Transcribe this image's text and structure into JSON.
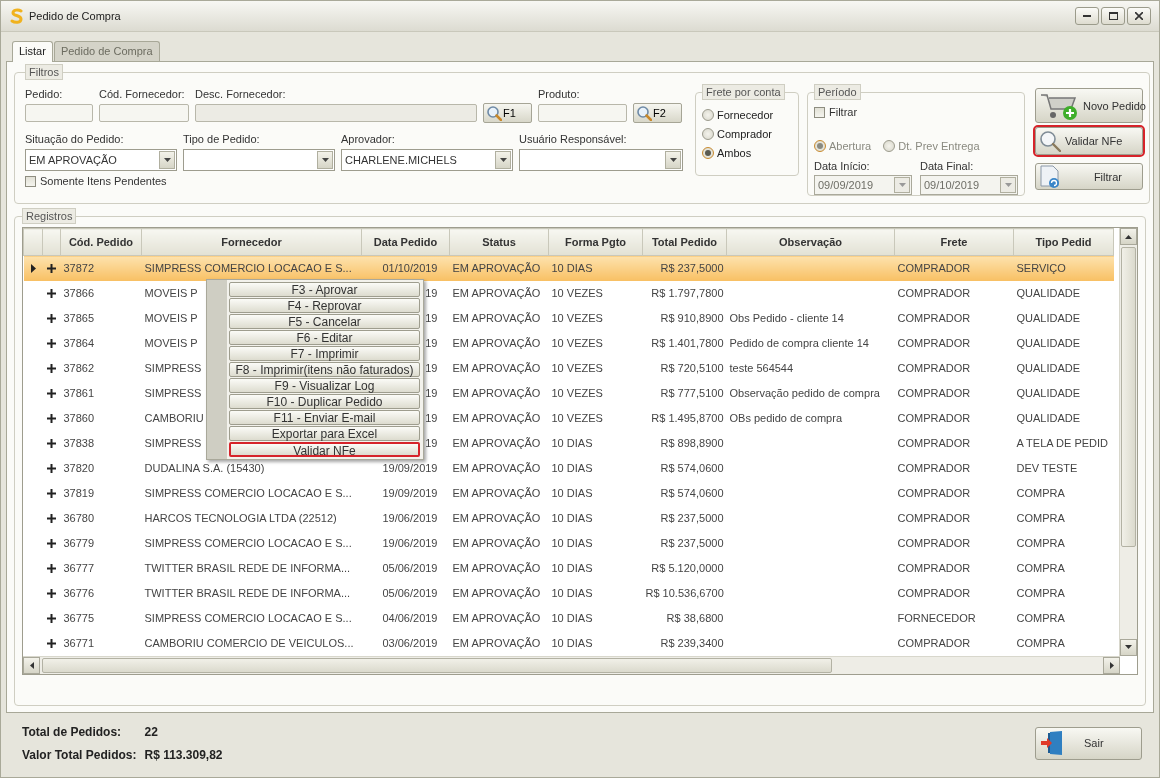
{
  "window": {
    "title": "Pedido de Compra"
  },
  "tabs": [
    {
      "label": "Listar",
      "selected": true
    },
    {
      "label": "Pedido de Compra",
      "selected": false
    }
  ],
  "filtros": {
    "title": "Filtros",
    "pedido": {
      "label": "Pedido:"
    },
    "cod_fornecedor": {
      "label": "Cód. Fornecedor:"
    },
    "desc_fornecedor": {
      "label": "Desc. Fornecedor:",
      "disabled": true
    },
    "f1_button": {
      "label": "F1"
    },
    "produto": {
      "label": "Produto:"
    },
    "f2_button": {
      "label": "F2"
    },
    "situacao": {
      "label": "Situação do Pedido:",
      "value": "EM APROVAÇÃO"
    },
    "tipo": {
      "label": "Tipo de Pedido:"
    },
    "aprovador": {
      "label": "Aprovador:",
      "value": "CHARLENE.MICHELS"
    },
    "usuario": {
      "label": "Usuário Responsável:"
    },
    "somente_pendentes": {
      "label": "Somente Itens Pendentes",
      "checked": false
    }
  },
  "frete": {
    "title": "Frete por conta",
    "options": [
      {
        "label": "Fornecedor",
        "selected": false
      },
      {
        "label": "Comprador",
        "selected": false
      },
      {
        "label": "Ambos",
        "selected": true
      }
    ]
  },
  "periodo": {
    "title": "Período",
    "filtrar": {
      "label": "Filtrar",
      "checked": false
    },
    "options": [
      {
        "label": "Abertura",
        "selected": true,
        "disabled": true
      },
      {
        "label": "Dt. Prev Entrega",
        "selected": false,
        "disabled": true
      }
    ],
    "data_inicio": {
      "label": "Data Início:",
      "value": "09/09/2019",
      "disabled": true
    },
    "data_final": {
      "label": "Data Final:",
      "value": "09/10/2019",
      "disabled": true
    }
  },
  "actions": [
    {
      "kind": "new",
      "label": "Novo Pedido",
      "highlighted": false
    },
    {
      "kind": "validate",
      "label": "Validar NFe",
      "highlighted": true
    },
    {
      "kind": "filter",
      "label": "Filtrar",
      "highlighted": false
    }
  ],
  "registros": {
    "title": "Registros",
    "columns": [
      "Cód. Pedido",
      "Fornecedor",
      "Data Pedido",
      "Status",
      "Forma Pgto",
      "Total Pedido",
      "Observação",
      "Frete",
      "Tipo Pedid"
    ],
    "rows": [
      {
        "selected": true,
        "cells": [
          "37872",
          "SIMPRESS COMERCIO LOCACAO E S...",
          "01/10/2019",
          "EM APROVAÇÃO",
          "10 DIAS",
          "R$ 237,5000",
          null,
          "COMPRADOR",
          "SERVIÇO"
        ]
      },
      {
        "selected": false,
        "cells": [
          "37866",
          "MOVEIS P",
          "19",
          "EM APROVAÇÃO",
          "10 VEZES",
          "R$ 1.797,7800",
          null,
          "COMPRADOR",
          "QUALIDADE"
        ]
      },
      {
        "selected": false,
        "cells": [
          "37865",
          "MOVEIS P",
          "19",
          "EM APROVAÇÃO",
          "10 VEZES",
          "R$ 910,8900",
          "Obs Pedido - cliente 14",
          "COMPRADOR",
          "QUALIDADE"
        ]
      },
      {
        "selected": false,
        "cells": [
          "37864",
          "MOVEIS P",
          "19",
          "EM APROVAÇÃO",
          "10 VEZES",
          "R$ 1.401,7800",
          "Pedido de compra cliente 14",
          "COMPRADOR",
          "QUALIDADE"
        ]
      },
      {
        "selected": false,
        "cells": [
          "37862",
          "SIMPRESS",
          "19",
          "EM APROVAÇÃO",
          "10 VEZES",
          "R$ 720,5100",
          "teste 564544",
          "COMPRADOR",
          "QUALIDADE"
        ]
      },
      {
        "selected": false,
        "cells": [
          "37861",
          "SIMPRESS",
          "19",
          "EM APROVAÇÃO",
          "10 VEZES",
          "R$ 777,5100",
          "Observação pedido de compra",
          "COMPRADOR",
          "QUALIDADE"
        ]
      },
      {
        "selected": false,
        "cells": [
          "37860",
          "CAMBORIU",
          "19",
          "EM APROVAÇÃO",
          "10 VEZES",
          "R$ 1.495,8700",
          "OBs pedido de compra",
          "COMPRADOR",
          "QUALIDADE"
        ]
      },
      {
        "selected": false,
        "cells": [
          "37838",
          "SIMPRESS",
          "19",
          "EM APROVAÇÃO",
          "10 DIAS",
          "R$ 898,8900",
          null,
          "COMPRADOR",
          "A TELA DE PEDID"
        ]
      },
      {
        "selected": false,
        "cells": [
          "37820",
          "DUDALINA S.A. (15430)",
          "19/09/2019",
          "EM APROVAÇÃO",
          "10 DIAS",
          "R$ 574,0600",
          null,
          "COMPRADOR",
          "DEV TESTE"
        ]
      },
      {
        "selected": false,
        "cells": [
          "37819",
          "SIMPRESS COMERCIO LOCACAO E S...",
          "19/09/2019",
          "EM APROVAÇÃO",
          "10 DIAS",
          "R$ 574,0600",
          null,
          "COMPRADOR",
          "COMPRA"
        ]
      },
      {
        "selected": false,
        "cells": [
          "36780",
          "HARCOS TECNOLOGIA LTDA (22512)",
          "19/06/2019",
          "EM APROVAÇÃO",
          "10 DIAS",
          "R$ 237,5000",
          null,
          "COMPRADOR",
          "COMPRA"
        ]
      },
      {
        "selected": false,
        "cells": [
          "36779",
          "SIMPRESS COMERCIO LOCACAO E S...",
          "19/06/2019",
          "EM APROVAÇÃO",
          "10 DIAS",
          "R$ 237,5000",
          null,
          "COMPRADOR",
          "COMPRA"
        ]
      },
      {
        "selected": false,
        "cells": [
          "36777",
          "TWITTER BRASIL REDE DE INFORMA...",
          "05/06/2019",
          "EM APROVAÇÃO",
          "10 DIAS",
          "R$ 5.120,0000",
          null,
          "COMPRADOR",
          "COMPRA"
        ]
      },
      {
        "selected": false,
        "cells": [
          "36776",
          "TWITTER BRASIL REDE DE INFORMA...",
          "05/06/2019",
          "EM APROVAÇÃO",
          "10 DIAS",
          "R$ 10.536,6700",
          null,
          "COMPRADOR",
          "COMPRA"
        ]
      },
      {
        "selected": false,
        "cells": [
          "36775",
          "SIMPRESS COMERCIO LOCACAO E S...",
          "04/06/2019",
          "EM APROVAÇÃO",
          "10 DIAS",
          "R$ 38,6800",
          null,
          "FORNECEDOR",
          "COMPRA"
        ]
      },
      {
        "selected": false,
        "cells": [
          "36771",
          "CAMBORIU COMERCIO DE VEICULOS...",
          "03/06/2019",
          "EM APROVAÇÃO",
          "10 DIAS",
          "R$ 239,3400",
          null,
          "COMPRADOR",
          "COMPRA"
        ]
      }
    ]
  },
  "context_menu": {
    "items": [
      {
        "label": "F3 - Aprovar",
        "highlighted": false
      },
      {
        "label": "F4 - Reprovar",
        "highlighted": false
      },
      {
        "label": "F5 - Cancelar",
        "highlighted": false
      },
      {
        "label": "F6 - Editar",
        "highlighted": false
      },
      {
        "label": "F7 - Imprimir",
        "highlighted": false
      },
      {
        "label": "F8 - Imprimir(itens não faturados)",
        "highlighted": false
      },
      {
        "label": "F9 - Visualizar Log",
        "highlighted": false
      },
      {
        "label": "F10 - Duplicar Pedido",
        "highlighted": false
      },
      {
        "label": "F11 - Enviar E-mail",
        "highlighted": false
      },
      {
        "label": "Exportar para Excel",
        "highlighted": false
      },
      {
        "label": "Validar NFe",
        "highlighted": true
      }
    ]
  },
  "summary": [
    {
      "label": "Total de Pedidos:",
      "value": "22"
    },
    {
      "label": "Valor Total Pedidos:",
      "value": "R$ 113.309,82"
    }
  ],
  "exit_button": {
    "label": "Sair"
  }
}
